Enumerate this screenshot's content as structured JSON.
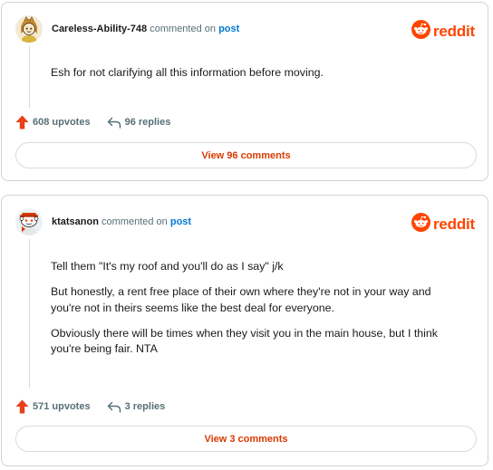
{
  "brand": {
    "wordmark": "reddit",
    "color": "#ff4500"
  },
  "comments": [
    {
      "username": "Careless-Ability-748",
      "action": "commented on",
      "target": "post",
      "avatar": "user-avatar-icon",
      "paragraphs": [
        "Esh for not clarifying all this information before moving."
      ],
      "upvotes": "608 upvotes",
      "replies": "96 replies",
      "view_button": "View 96 comments"
    },
    {
      "username": "ktatsanon",
      "action": "commented on",
      "target": "post",
      "avatar": "snoo-avatar-icon",
      "paragraphs": [
        "Tell them \"It's my roof and you'll do as I say\" j/k",
        "But honestly, a rent free place of their own where they're not in your way and you're not in theirs seems like the best deal for everyone.",
        "Obviously there will be times when they visit you in the main house, but I think you're being fair. NTA"
      ],
      "upvotes": "571 upvotes",
      "replies": "3 replies",
      "view_button": "View 3 comments"
    }
  ]
}
